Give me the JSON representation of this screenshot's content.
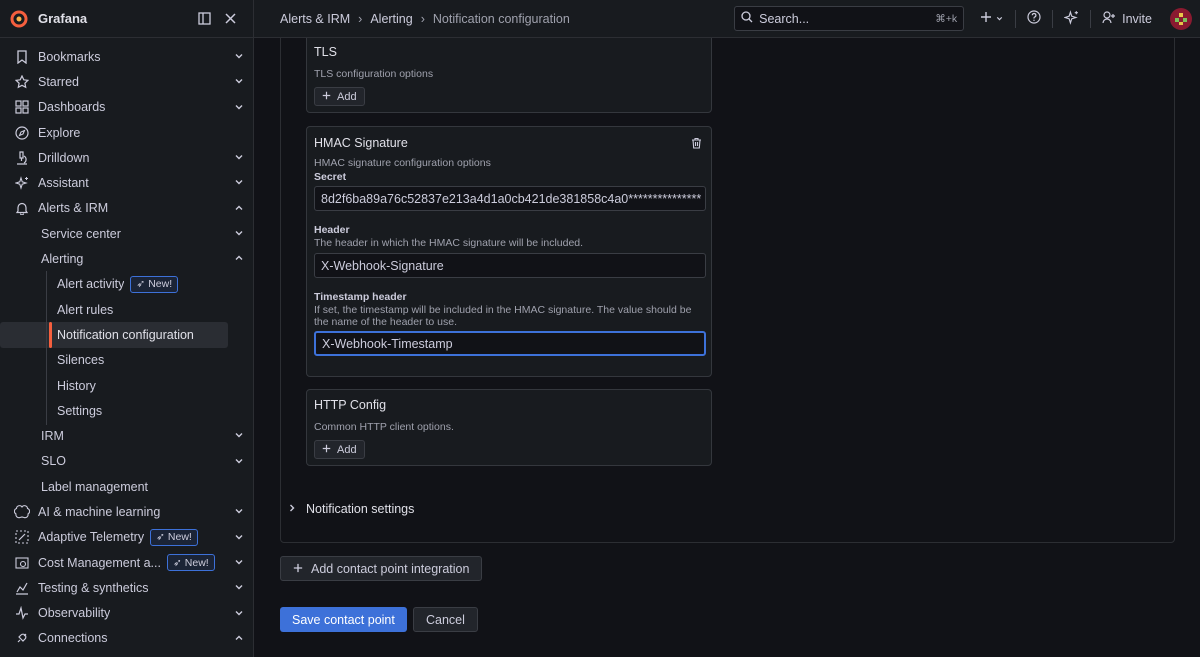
{
  "colors": {
    "accent": "#3d71d9",
    "brand": "#f55f3e",
    "active_marker": "#f55f3e",
    "background": "#111217",
    "panel": "#181b1f"
  },
  "sidebar": {
    "brand": "Grafana",
    "items": [
      {
        "label": "Bookmarks",
        "icon": "bookmark-icon"
      },
      {
        "label": "Starred",
        "icon": "star-icon"
      },
      {
        "label": "Dashboards",
        "icon": "dashboards-grid-icon"
      },
      {
        "label": "Explore",
        "icon": "compass-icon"
      },
      {
        "label": "Drilldown",
        "icon": "microscope-icon"
      },
      {
        "label": "Assistant",
        "icon": "sparkle-icon"
      },
      {
        "label": "Alerts & IRM",
        "icon": "bell-icon"
      },
      {
        "label": "Service center"
      },
      {
        "label": "Alerting"
      },
      {
        "label": "Alert activity",
        "badge": "New!"
      },
      {
        "label": "Alert rules"
      },
      {
        "label": "Notification configuration"
      },
      {
        "label": "Silences"
      },
      {
        "label": "History"
      },
      {
        "label": "Settings"
      },
      {
        "label": "IRM"
      },
      {
        "label": "SLO"
      },
      {
        "label": "Label management"
      },
      {
        "label": "AI & machine learning",
        "icon": "brain-icon"
      },
      {
        "label": "Adaptive Telemetry",
        "icon": "adaptive-icon",
        "badge": "New!"
      },
      {
        "label": "Cost Management a...",
        "icon": "cost-icon",
        "badge": "New!"
      },
      {
        "label": "Testing & synthetics",
        "icon": "chart-icon"
      },
      {
        "label": "Observability",
        "icon": "pulse-icon"
      },
      {
        "label": "Connections",
        "icon": "plug-icon"
      }
    ]
  },
  "topbar": {
    "breadcrumbs": [
      "Alerts & IRM",
      "Alerting",
      "Notification configuration"
    ],
    "search_placeholder": "Search...",
    "search_shortcut": "⌘+k",
    "invite_label": "Invite"
  },
  "form": {
    "tls": {
      "title": "TLS",
      "description": "TLS configuration options",
      "add_label": "Add"
    },
    "hmac": {
      "title": "HMAC Signature",
      "description": "HMAC signature configuration options",
      "secret_label": "Secret",
      "secret_value": "8d2f6ba89a76c52837e213a4d1a0cb421de381858c4a0***************",
      "header_label": "Header",
      "header_description": "The header in which the HMAC signature will be included.",
      "header_value": "X-Webhook-Signature",
      "timestamp_label": "Timestamp header",
      "timestamp_description": "If set, the timestamp will be included in the HMAC signature. The value should be the name of the header to use.",
      "timestamp_value": "X-Webhook-Timestamp"
    },
    "http": {
      "title": "HTTP Config",
      "description": "Common HTTP client options.",
      "add_label": "Add"
    },
    "notification_settings": "Notification settings",
    "add_integration": "Add contact point integration",
    "save": "Save contact point",
    "cancel": "Cancel"
  }
}
